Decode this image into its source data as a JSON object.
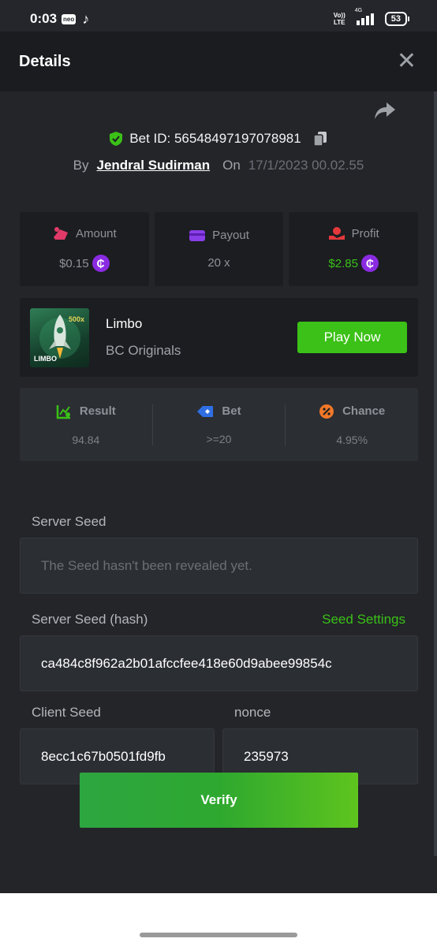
{
  "status_bar": {
    "time": "0:03",
    "neo": "neo",
    "volte_line1": "Vo))",
    "volte_line2": "LTE",
    "network": "4G",
    "battery": "53"
  },
  "modal": {
    "title": "Details",
    "close_symbol": "✕"
  },
  "bet": {
    "id_label": "Bet ID: 56548497197078981",
    "by_label": "By",
    "user": "Jendral Sudirman",
    "on_label": "On",
    "date": "17/1/2023 00.02.55"
  },
  "stats": {
    "amount_label": "Amount",
    "amount_value": "$0.15",
    "payout_label": "Payout",
    "payout_value": "20 x",
    "profit_label": "Profit",
    "profit_value": "$2.85",
    "coin_symbol": "₵"
  },
  "game": {
    "thumb_multiplier": "500x",
    "thumb_logo": "LIMBO",
    "name": "Limbo",
    "provider": "BC Originals",
    "play_label": "Play Now"
  },
  "result": {
    "result_label": "Result",
    "result_value": "94.84",
    "bet_label": "Bet",
    "bet_value": ">=20",
    "chance_label": "Chance",
    "chance_value": "4.95%"
  },
  "seeds": {
    "server_seed_label": "Server Seed",
    "server_seed_value": "The Seed hasn't been revealed yet.",
    "server_hash_label": "Server Seed (hash)",
    "seed_settings_label": "Seed Settings",
    "server_hash_value": "ca484c8f962a2b01afccfee418e60d9abee99854c",
    "client_seed_label": "Client Seed",
    "client_seed_value": "8ecc1c67b0501fd9fb",
    "nonce_label": "nonce",
    "nonce_value": "235973"
  },
  "verify_label": "Verify",
  "colors": {
    "accent_green": "#3bc117",
    "coin_purple": "#8a2be2",
    "panel_bg": "#232529",
    "header_bg": "#1a1c20"
  },
  "icons": [
    "share-icon",
    "shield-check-icon",
    "copy-icon",
    "amount-icon",
    "payout-card-icon",
    "profit-icon",
    "result-chart-icon",
    "bet-tag-icon",
    "chance-percent-icon",
    "close-icon"
  ]
}
